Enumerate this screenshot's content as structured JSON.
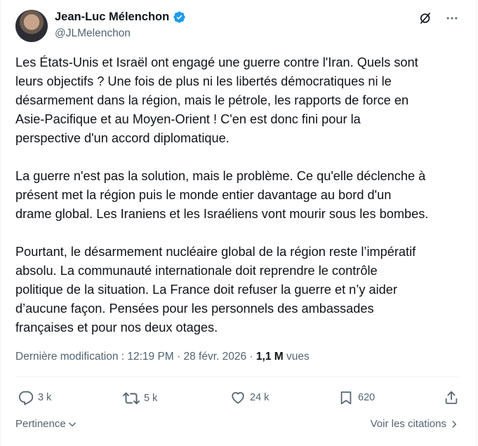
{
  "author": {
    "display_name": "Jean-Luc Mélenchon",
    "handle": "@JLMelenchon",
    "verified_color": "#1d9bf0"
  },
  "post": {
    "paragraphs": [
      "Les États-Unis et Israël ont engagé une guerre contre l'Iran. Quels sont\nleurs objectifs ? Une fois de plus ni les libertés démocratiques ni le\ndésarmement dans la région, mais le pétrole, les rapports de force en\nAsie-Pacifique et au Moyen-Orient ! C'en est donc fini pour la\nperspective d'un accord diplomatique.",
      "La guerre n'est pas la solution, mais le problème. Ce qu'elle déclenche à\nprésent met la région puis le monde entier davantage au bord d'un\ndrame global. Les Iraniens et les Israéliens vont mourir sous les bombes.",
      "Pourtant, le désarmement nucléaire global de la région reste l’impératif\nabsolu. La communauté internationale doit reprendre le contrôle\npolitique de la situation. La France doit refuser la guerre et n’y aider\nd’aucune façon. Pensées pour les personnels des ambassades\nfrançaises et pour nos deux otages."
    ]
  },
  "meta": {
    "prefix": "Dernière modification : 12:19 PM · 28 févr. 2026 · ",
    "views_count": "1,1 M",
    "views_label": " vues"
  },
  "actions": {
    "replies": "3 k",
    "reposts": "5 k",
    "likes": "24 k",
    "bookmarks": "620"
  },
  "footer": {
    "sort_label": "Pertinence",
    "quotes_label": "Voir les citations"
  },
  "icons": {
    "top": [
      "grok-icon",
      "more-icon"
    ],
    "actions": [
      "reply-icon",
      "repost-icon",
      "like-icon",
      "bookmark-icon",
      "share-icon"
    ]
  }
}
